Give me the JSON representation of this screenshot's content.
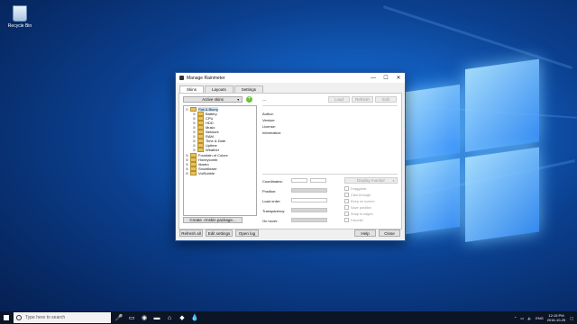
{
  "desktop": {
    "recycle_bin_label": "Recycle Bin"
  },
  "window": {
    "title": "Manage Rainmeter",
    "controls": {
      "minimize": "—",
      "maximize": "☐",
      "close": "✕"
    },
    "tabs": [
      "Skins",
      "Layouts",
      "Settings"
    ],
    "active_tab": "Skins",
    "active_skins_label": "Active skins",
    "add_icon": "+",
    "tree": {
      "root": "Flat & Blurry",
      "root_children": [
        "Battery",
        "CPU",
        "HDD",
        "Music",
        "Network",
        "RAM",
        "Time & Date",
        "Uptime",
        "Weather"
      ],
      "others": [
        "Fountain of Colors",
        "Honeycomb",
        "illustro",
        "Snowflower",
        "VolSubble"
      ]
    },
    "create_package_label": "Create .rmskin package...",
    "skin_name": "...",
    "top_buttons": {
      "load": "Load",
      "refresh": "Refresh",
      "edit": "Edit"
    },
    "info_labels": [
      "Author:",
      "Version:",
      "License:",
      "Information:"
    ],
    "settings_labels": {
      "coordinates": "Coordinates:",
      "position": "Position:",
      "load_order": "Load order:",
      "transparency": "Transparency:",
      "on_hover": "On hover:"
    },
    "display_monitor_label": "Display monitor",
    "checkboxes": [
      "Draggable",
      "Click through",
      "Keep on screen",
      "Save position",
      "Snap to edges",
      "Favorite"
    ],
    "bottom_buttons": {
      "refresh_all": "Refresh all",
      "edit_settings": "Edit settings",
      "open_log": "Open log",
      "help": "Help",
      "close": "Close"
    }
  },
  "taskbar": {
    "search_placeholder": "Type here to search",
    "language": "ENG",
    "time": "12:15 PM",
    "date": "2016-10-25"
  }
}
